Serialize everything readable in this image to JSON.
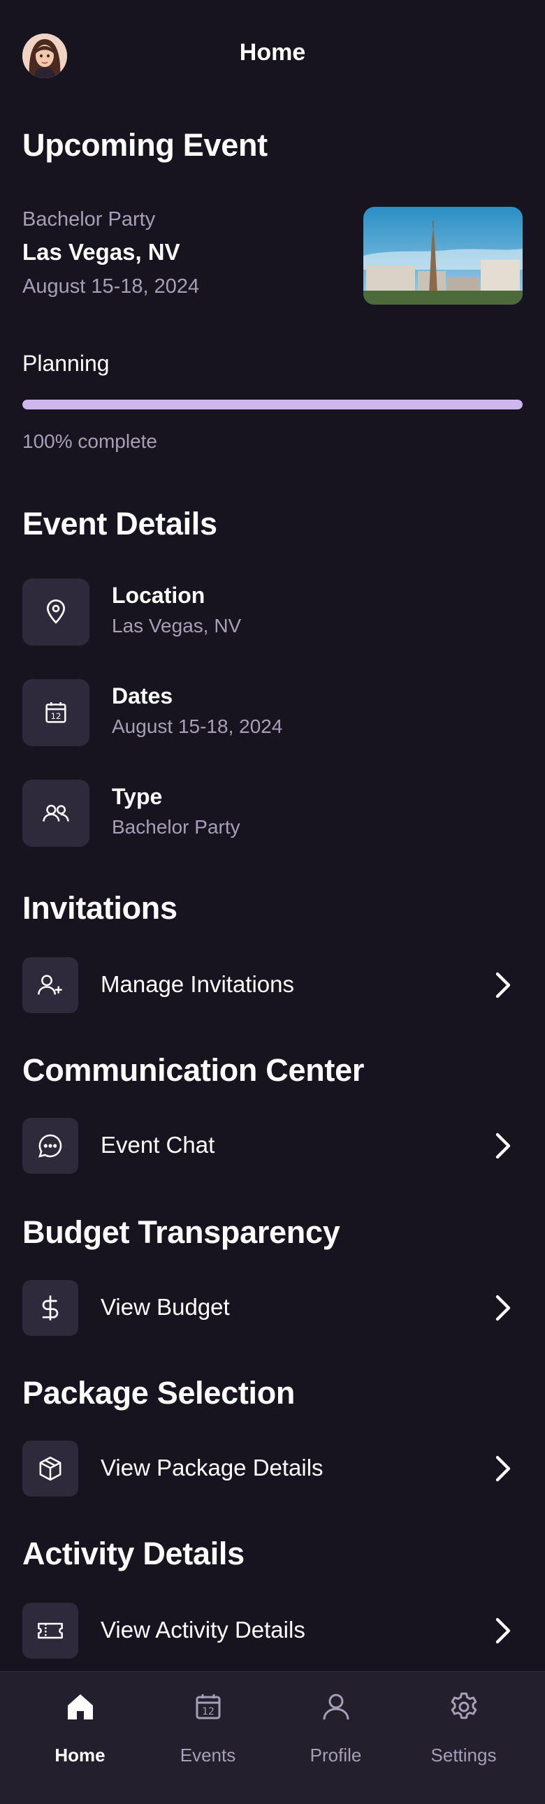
{
  "header": {
    "title": "Home",
    "avatar_icon": "user-avatar"
  },
  "upcoming": {
    "heading": "Upcoming Event",
    "type": "Bachelor Party",
    "location": "Las Vegas, NV",
    "dates": "August 15-18, 2024",
    "planning_label": "Planning",
    "progress_percent": 100,
    "progress_text": "100% complete",
    "accent_color": "#cdb7ec"
  },
  "event_details": {
    "heading": "Event Details",
    "items": [
      {
        "icon": "location-pin-icon",
        "title": "Location",
        "value": "Las Vegas, NV"
      },
      {
        "icon": "calendar-icon",
        "title": "Dates",
        "value": "August 15-18, 2024"
      },
      {
        "icon": "users-icon",
        "title": "Type",
        "value": "Bachelor Party"
      }
    ]
  },
  "sections": [
    {
      "heading": "Invitations",
      "icon": "add-user-icon",
      "label": "Manage Invitations"
    },
    {
      "heading": "Communication Center",
      "icon": "chat-bubble-icon",
      "label": "Event Chat"
    },
    {
      "heading": "Budget Transparency",
      "icon": "dollar-icon",
      "label": "View Budget"
    },
    {
      "heading": "Package Selection",
      "icon": "package-icon",
      "label": "View Package Details"
    },
    {
      "heading": "Activity Details",
      "icon": "ticket-icon",
      "label": "View Activity Details"
    }
  ],
  "bottom_nav": {
    "items": [
      {
        "icon": "home-icon",
        "label": "Home",
        "active": true
      },
      {
        "icon": "calendar-icon",
        "label": "Events",
        "active": false
      },
      {
        "icon": "profile-icon",
        "label": "Profile",
        "active": false
      },
      {
        "icon": "settings-gear-icon",
        "label": "Settings",
        "active": false
      }
    ]
  }
}
